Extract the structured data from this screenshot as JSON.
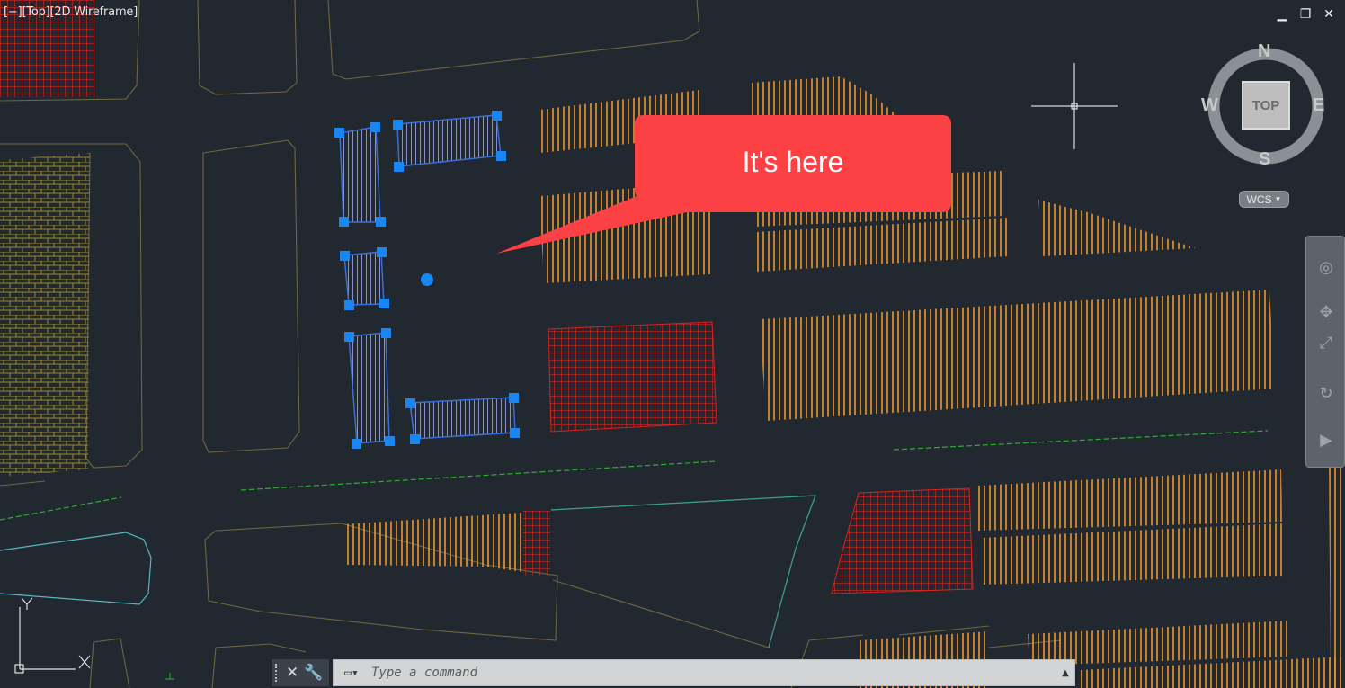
{
  "viewport": {
    "controls": [
      "[−]",
      "[Top]",
      "[2D Wireframe]"
    ]
  },
  "window_buttons": {
    "minimize": "▁",
    "restore": "❐",
    "close": "✕"
  },
  "callout": {
    "text": "It's here"
  },
  "viewcube": {
    "north": "N",
    "south": "S",
    "east": "E",
    "west": "W",
    "face": "TOP",
    "coord_system": "WCS"
  },
  "ucs": {
    "y_label": "Y",
    "x_label": "X"
  },
  "command_line": {
    "placeholder": "Type a command",
    "close_glyph": "✕",
    "customize_glyph": "🔧",
    "history_glyph": "▲"
  },
  "navbar": {
    "tools": [
      "steering-wheel",
      "pan",
      "zoom",
      "orbit",
      "showmotion"
    ]
  },
  "colors": {
    "background": "#212830",
    "hatch_orange": "#f0952a",
    "hatch_red": "#d9231f",
    "hatch_olive": "#9b8a2e",
    "hatch_green": "#2fae2f",
    "outline": "#6e6740",
    "selection": "#1a86f2",
    "callout": "#fb4143",
    "cyan_line": "#57b7c0"
  }
}
